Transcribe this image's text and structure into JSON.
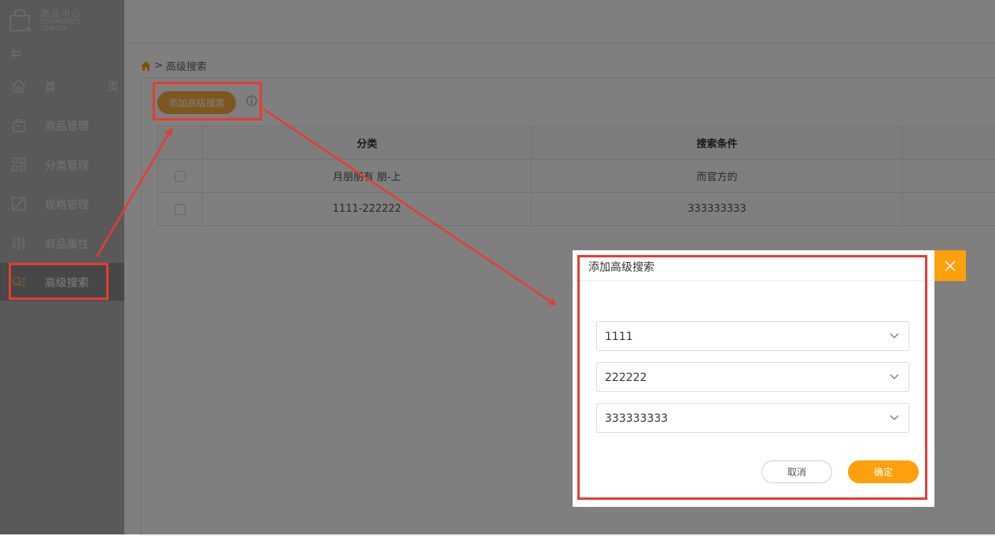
{
  "app": {
    "logo_cn": "商品中心",
    "logo_en": "COMMODITY CENTER"
  },
  "sidebar": {
    "collapse_icon": "collapse-arrow-icon",
    "items": [
      {
        "label": "首　页",
        "icon": "home-icon"
      },
      {
        "label": "商品管理",
        "icon": "shopping-bag-icon"
      },
      {
        "label": "分类管理",
        "icon": "grid-icon"
      },
      {
        "label": "规格管理",
        "icon": "spec-box-icon"
      },
      {
        "label": "商品属性",
        "icon": "sliders-icon"
      },
      {
        "label": "高级搜索",
        "icon": "search-list-icon"
      }
    ],
    "active_index": 5
  },
  "breadcrumb": {
    "home_icon": "home-icon",
    "separator": ">",
    "current": "高级搜索"
  },
  "toolbar": {
    "add_label": "添加高级搜索",
    "info_icon": "info-icon"
  },
  "table": {
    "headers": [
      "",
      "分类",
      "搜索条件",
      ""
    ],
    "rows": [
      {
        "category": "月朋朋有 朋-上",
        "condition": "而官方的"
      },
      {
        "category": "1111-222222",
        "condition": "333333333"
      }
    ]
  },
  "modal": {
    "title": "添加高级搜索",
    "selects": [
      "1111",
      "222222",
      "333333333"
    ],
    "cancel_label": "取消",
    "ok_label": "确定",
    "close_icon": "close-icon"
  },
  "colors": {
    "accent": "#fca00d",
    "add_button": "#fcae3f",
    "annotation_red": "#e63c35",
    "sidebar": "#b3b3b3",
    "sidebar_active": "#8f8f8f"
  }
}
